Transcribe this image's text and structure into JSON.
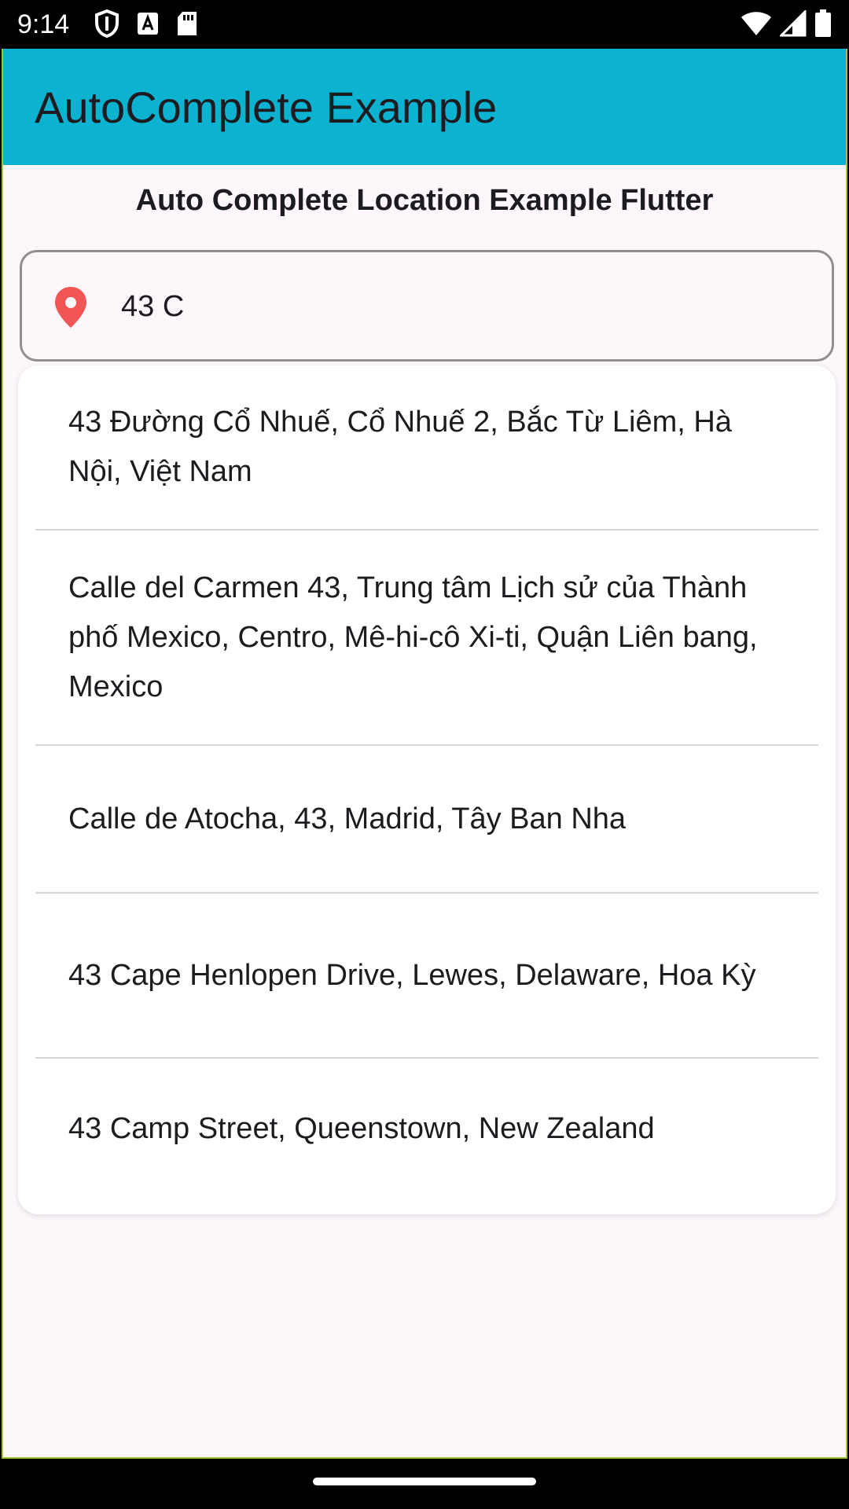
{
  "status_bar": {
    "time": "9:14",
    "left_icons": [
      "shield-icon",
      "text-a-icon",
      "sd-card-icon"
    ],
    "right_icons": [
      "wifi-icon",
      "signal-icon",
      "battery-icon"
    ]
  },
  "app_bar": {
    "title": "AutoComplete Example",
    "color": "#0bb3d1"
  },
  "page": {
    "title": "Auto Complete Location Example Flutter"
  },
  "search": {
    "icon": "location-pin-icon",
    "icon_color": "#f25555",
    "value": "43 C"
  },
  "suggestions": [
    {
      "label": "43 Đường Cổ Nhuế, Cổ Nhuế 2, Bắc Từ Liêm, Hà Nội, Việt Nam"
    },
    {
      "label": "Calle del Carmen 43, Trung tâm Lịch sử của Thành phố Mexico, Centro, Mê-hi-cô Xi-ti, Quận Liên bang, Mexico"
    },
    {
      "label": "Calle de Atocha, 43, Madrid, Tây Ban Nha"
    },
    {
      "label": "43 Cape Henlopen Drive, Lewes, Delaware, Hoa Kỳ"
    },
    {
      "label": "43 Camp Street, Queenstown, New Zealand"
    }
  ]
}
